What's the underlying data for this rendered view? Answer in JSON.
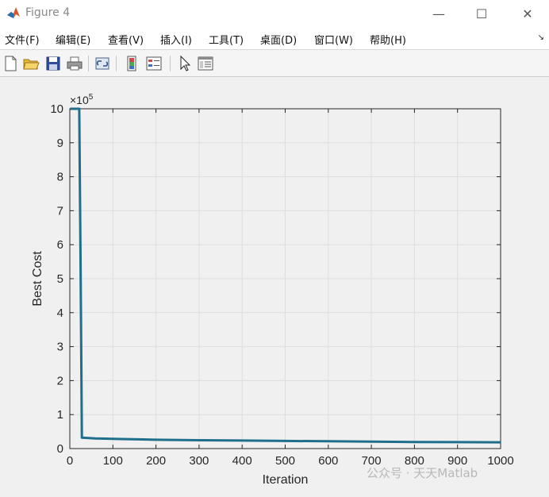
{
  "window": {
    "title": "Figure 4",
    "minimize_glyph": "—",
    "maximize_glyph": "☐",
    "close_glyph": "✕",
    "app_icon": "matlab-logo-icon"
  },
  "menu": {
    "items": [
      "文件(F)",
      "编辑(E)",
      "查看(V)",
      "插入(I)",
      "工具(T)",
      "桌面(D)",
      "窗口(W)",
      "帮助(H)"
    ],
    "dock_glyph": "↘"
  },
  "toolbar": {
    "icons": [
      "new-figure-icon",
      "open-file-icon",
      "save-icon",
      "print-icon",
      "link-icon",
      "colorbar-icon",
      "legend-icon",
      "pointer-icon",
      "property-editor-icon"
    ]
  },
  "chart_data": {
    "type": "line",
    "xlabel": "Iteration",
    "ylabel": "Best Cost",
    "y_exponent_base": "×10",
    "y_exponent_power": "5",
    "xlim": [
      0,
      1000
    ],
    "ylim": [
      0,
      1000000
    ],
    "xticks": [
      0,
      100,
      200,
      300,
      400,
      500,
      600,
      700,
      800,
      900,
      1000
    ],
    "yticks": [
      0,
      1,
      2,
      3,
      4,
      5,
      6,
      7,
      8,
      9,
      10
    ],
    "grid": true,
    "line_color": "#1f6e8c",
    "series": [
      {
        "x": [
          1,
          22,
          25,
          28,
          60,
          120,
          160,
          200,
          300,
          400,
          500,
          600,
          700,
          800,
          900,
          1000
        ],
        "y": [
          1000000,
          1000000,
          530000,
          32000,
          30000,
          28000,
          27000,
          26000,
          24500,
          23500,
          22500,
          21500,
          20500,
          19500,
          19000,
          18500
        ]
      }
    ]
  },
  "watermark": "公众号 · 天天Matlab"
}
